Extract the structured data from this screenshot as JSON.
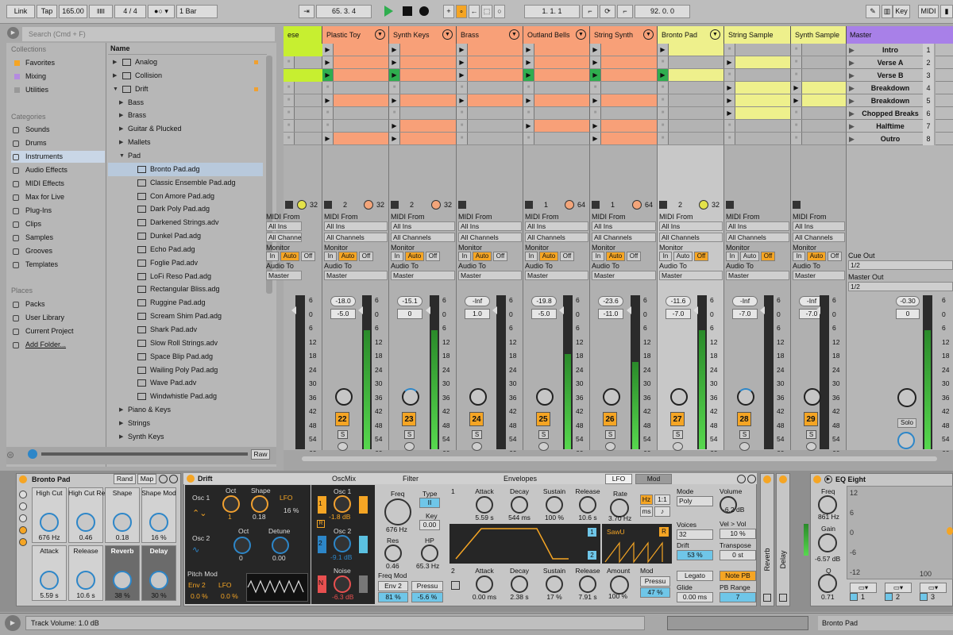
{
  "transport": {
    "link": "Link",
    "tap": "Tap",
    "tempo": "165.00",
    "sig": "4 / 4",
    "quant": "1 Bar",
    "pos": "65. 3. 4",
    "loop_start": "1. 1. 1",
    "loop_len": "92. 0. 0",
    "key": "Key",
    "midi": "MIDI"
  },
  "browser": {
    "search_placeholder": "Search (Cmd + F)",
    "collections_title": "Collections",
    "collections": [
      "Favorites",
      "Mixing",
      "Utilities"
    ],
    "categories_title": "Categories",
    "categories": [
      "Sounds",
      "Drums",
      "Instruments",
      "Audio Effects",
      "MIDI Effects",
      "Max for Live",
      "Plug-Ins",
      "Clips",
      "Samples",
      "Grooves",
      "Templates"
    ],
    "places_title": "Places",
    "places": [
      "Packs",
      "User Library",
      "Current Project",
      "Add Folder..."
    ],
    "name_header": "Name",
    "raw": "Raw",
    "files": [
      "Analog",
      "Collision",
      "Drift",
      "Bass",
      "Brass",
      "Guitar & Plucked",
      "Mallets",
      "Pad",
      "Bronto Pad.adg",
      "Classic Ensemble Pad.adg",
      "Con Amore Pad.adg",
      "Dark Poly Pad.adg",
      "Darkened Strings.adv",
      "Dunkel Pad.adg",
      "Echo Pad.adg",
      "Foglie Pad.adv",
      "LoFi Reso Pad.adg",
      "Rectangular Bliss.adg",
      "Ruggine Pad.adg",
      "Scream Shim Pad.adg",
      "Shark Pad.adv",
      "Slow Roll Strings.adv",
      "Space Blip Pad.adg",
      "Wailing Poly Pad.adg",
      "Wave Pad.adv",
      "Windwhistle Pad.adg",
      "Piano & Keys",
      "Strings",
      "Synth Keys"
    ]
  },
  "tracks": [
    {
      "name": "ese",
      "color": "#c7ef30",
      "vol": "",
      "pan": "",
      "num": "",
      "n1": "",
      "n2": "32"
    },
    {
      "name": "Plastic Toy",
      "color": "#f8a078",
      "vol": "-18.0",
      "pan": "-5.0",
      "num": "22",
      "n1": "2",
      "n2": "32"
    },
    {
      "name": "Synth Keys",
      "color": "#f8a078",
      "vol": "-15.1",
      "pan": "0",
      "num": "23",
      "n1": "2",
      "n2": "32"
    },
    {
      "name": "Brass",
      "color": "#f8a078",
      "vol": "-Inf",
      "pan": "1.0",
      "num": "24",
      "n1": "",
      "n2": ""
    },
    {
      "name": "Outland Bells",
      "color": "#f8a078",
      "vol": "-19.8",
      "pan": "-5.0",
      "num": "25",
      "n1": "1",
      "n2": "64"
    },
    {
      "name": "String Synth",
      "color": "#f8a078",
      "vol": "-23.6",
      "pan": "-11.0",
      "num": "26",
      "n1": "1",
      "n2": "64"
    },
    {
      "name": "Bronto Pad",
      "color": "#eef08c",
      "vol": "-11.6",
      "pan": "-7.0",
      "num": "27",
      "n1": "2",
      "n2": "32"
    },
    {
      "name": "String Sample",
      "color": "#eef08c",
      "vol": "-Inf",
      "pan": "-7.0",
      "num": "28",
      "n1": "",
      "n2": ""
    },
    {
      "name": "Synth Sample",
      "color": "#eef08c",
      "vol": "-Inf",
      "pan": "-7.0",
      "num": "29",
      "n1": "",
      "n2": ""
    }
  ],
  "mixer": {
    "midi_from": "MIDI From",
    "all_ins": "All Ins",
    "all_channels": "All Channels",
    "monitor": "Monitor",
    "in": "In",
    "auto": "Auto",
    "off": "Off",
    "audio_to": "Audio To",
    "master": "Master",
    "s": "S",
    "cue_out": "Cue Out",
    "cue_val": "1/2",
    "master_out": "Master Out",
    "master_val": "1/2",
    "master_vol": "-0.30",
    "master_pan": "0",
    "solo": "Solo"
  },
  "master": {
    "name": "Master",
    "scenes": [
      "Intro",
      "Verse A",
      "Verse B",
      "Breakdown",
      "Breakdown",
      "Chopped Breaks",
      "Halftime",
      "Outro"
    ],
    "nums": [
      "1",
      "2",
      "3",
      "4",
      "5",
      "6",
      "7",
      "8"
    ]
  },
  "meter_scale": [
    "6",
    "0",
    "6",
    "12",
    "18",
    "24",
    "30",
    "36",
    "42",
    "48",
    "54",
    "60"
  ],
  "rack": {
    "name": "Bronto Pad",
    "rand": "Rand",
    "map": "Map",
    "macros": [
      {
        "l": "High Cut",
        "v": "676 Hz"
      },
      {
        "l": "High Cut Reso",
        "v": "0.46"
      },
      {
        "l": "Shape",
        "v": "0.18"
      },
      {
        "l": "Shape Mod",
        "v": "16 %"
      },
      {
        "l": "Attack",
        "v": "5.59 s"
      },
      {
        "l": "Release",
        "v": "10.6 s"
      },
      {
        "l": "Reverb",
        "v": "38 %"
      },
      {
        "l": "Delay",
        "v": "30 %"
      }
    ]
  },
  "drift": {
    "name": "Drift",
    "oscmix": "OscMix",
    "filter": "Filter",
    "envelopes": "Envelopes",
    "lfo": "LFO",
    "mod": "Mod",
    "osc1": "Osc 1",
    "oct": "Oct",
    "shape": "Shape",
    "lfo_src": "LFO",
    "oct_v": "1",
    "shape_v": "0.18",
    "shape_mod": "16 %",
    "osc1_vol": "-1.8 dB",
    "osc2": "Osc 2",
    "oct2": "Oct",
    "detune": "Detune",
    "oct2_v": "0",
    "detune_v": "0.00",
    "osc2_vol": "-9.1 dB",
    "noise": "Noise",
    "noise_vol": "-6.3 dB",
    "pitchmod": "Pitch Mod",
    "env2": "Env 2",
    "lfo2": "LFO",
    "pm1": "0.0 %",
    "pm2": "0.0 %",
    "freq": "Freq",
    "freq_v": "676 Hz",
    "type": "Type",
    "type_v": "II",
    "key": "Key",
    "key_v": "0.00",
    "res": "Res",
    "res_v": "0.46",
    "hp": "HP",
    "hp_v": "65.3 Hz",
    "freqmod": "Freq Mod",
    "fm_src1": "Env 2",
    "fm_src2": "Pressu",
    "fm_v1": "81 %",
    "fm_v2": "-5.6 %",
    "e1": "1",
    "attack": "Attack",
    "decay": "Decay",
    "sustain": "Sustain",
    "release": "Release",
    "a1": "5.59 s",
    "d1": "544 ms",
    "s1": "100 %",
    "r1": "10.6 s",
    "e2": "2",
    "a2": "0.00 ms",
    "d2": "2.38 s",
    "s2": "17 %",
    "r2": "7.91 s",
    "rate": "Rate",
    "hz": "Hz",
    "r11": "1:1",
    "ms": "ms",
    "rate_v": "3.70 Hz",
    "wave": "SawU",
    "amount": "Amount",
    "amount_v": "100 %",
    "mod_l": "Mod",
    "mod_src": "Pressu",
    "mod_v": "47 %",
    "mode": "Mode",
    "mode_v": "Poly",
    "voices": "Voices",
    "voices_v": "32",
    "drift_l": "Drift",
    "drift_v": "53 %",
    "legato": "Legato",
    "glide": "Glide",
    "glide_v": "0.00 ms",
    "volume": "Volume",
    "volume_v": "-6.2 dB",
    "velvol": "Vel > Vol",
    "velvol_v": "10 %",
    "transpose": "Transpose",
    "transpose_v": "0 st",
    "notepb": "Note PB",
    "pbrange": "PB Range",
    "pbrange_v": "7"
  },
  "fx": {
    "reverb": "Reverb",
    "delay": "Delay"
  },
  "eq": {
    "name": "EQ Eight",
    "freq": "Freq",
    "freq_v": "861 Hz",
    "gain": "Gain",
    "gain_v": "-6.57 dB",
    "q": "Q",
    "q_v": "0.71",
    "scale": [
      "12",
      "6",
      "0",
      "-6",
      "-12"
    ],
    "x100": "100",
    "bands": [
      "1",
      "2",
      "3"
    ]
  },
  "status": {
    "text": "Track Volume: 1.0 dB",
    "track": "Bronto Pad"
  },
  "colors": {
    "orange": "#f5a524",
    "blue": "#2d86c8",
    "clip_orange": "#f8a078",
    "clip_yellow": "#eef08c",
    "lime": "#c7ef30",
    "master_purple": "#a880e8"
  }
}
